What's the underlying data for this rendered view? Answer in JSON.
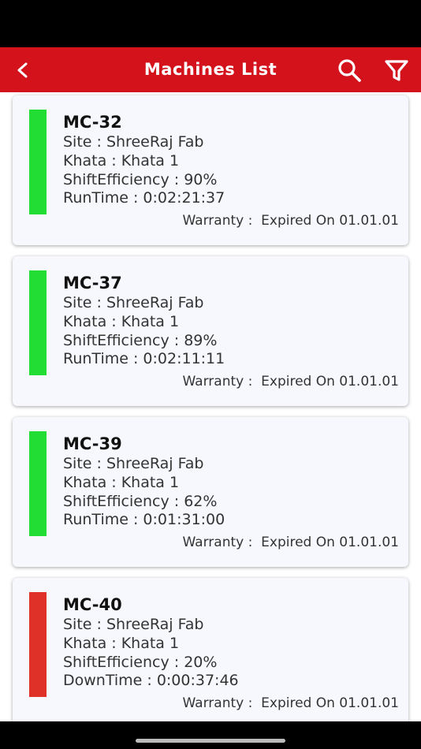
{
  "header": {
    "title": "Machines List",
    "color": "#d4121c",
    "back_icon": "chevron-left-icon",
    "search_icon": "search-icon",
    "filter_icon": "filter-icon"
  },
  "status_colors": {
    "running": "#22dd33",
    "down": "#e03128"
  },
  "machines": [
    {
      "name": "MC-32",
      "status": "running",
      "site": "Site : ShreeRaj Fab",
      "khata": "Khata : Khata 1",
      "efficiency": "ShiftEfficiency : 90%",
      "time": "RunTime : 0:02:21:37",
      "warranty_label": "Warranty :",
      "warranty_value": "Expired On 01.01.01"
    },
    {
      "name": "MC-37",
      "status": "running",
      "site": "Site : ShreeRaj Fab",
      "khata": "Khata : Khata 1",
      "efficiency": "ShiftEfficiency : 89%",
      "time": "RunTime : 0:02:11:11",
      "warranty_label": "Warranty :",
      "warranty_value": "Expired On 01.01.01"
    },
    {
      "name": "MC-39",
      "status": "running",
      "site": "Site : ShreeRaj Fab",
      "khata": "Khata : Khata 1",
      "efficiency": "ShiftEfficiency : 62%",
      "time": "RunTime : 0:01:31:00",
      "warranty_label": "Warranty :",
      "warranty_value": "Expired On 01.01.01"
    },
    {
      "name": "MC-40",
      "status": "down",
      "site": "Site : ShreeRaj Fab",
      "khata": "Khata : Khata 1",
      "efficiency": "ShiftEfficiency : 20%",
      "time": "DownTime : 0:00:37:46",
      "warranty_label": "Warranty :",
      "warranty_value": "Expired On 01.01.01"
    }
  ]
}
